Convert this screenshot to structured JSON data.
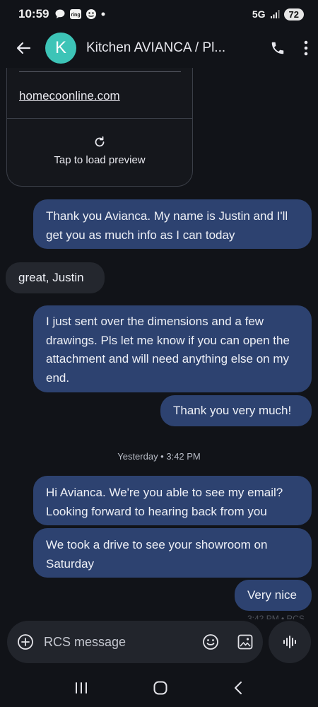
{
  "status_bar": {
    "time": "10:59",
    "network": "5G",
    "battery": "72",
    "icons": [
      "chat-bubble-icon",
      "ring-app-icon",
      "emoji-status-icon",
      "dot-icon",
      "signal-icon"
    ]
  },
  "app_bar": {
    "avatar_letter": "K",
    "avatar_color": "#3dc4b7",
    "title": "Kitchen AVIANCA / Pl..."
  },
  "link_preview": {
    "domain": "homecoonline.com",
    "action_label": "Tap to load preview"
  },
  "messages": [
    {
      "direction": "outgoing",
      "text": "Thank you Avianca.  My name is Justin and I'll get you as much info as I can today"
    },
    {
      "direction": "incoming",
      "text": "great, Justin"
    },
    {
      "direction": "outgoing",
      "text": "I just sent over the dimensions and a few drawings.  Pls let me know if you can open the attachment and will need anything else on my end."
    },
    {
      "direction": "outgoing",
      "text": "Thank you very much!"
    },
    {
      "direction": "outgoing",
      "text": "Hi Avianca.  We're you able to see my email? Looking forward to hearing back from you"
    },
    {
      "direction": "outgoing",
      "text": "We took a drive to see your showroom on Saturday"
    },
    {
      "direction": "outgoing",
      "text": "Very nice"
    }
  ],
  "timestamp_divider": "Yesterday • 3:42 PM",
  "faded_timestamp": "3:42 PM • RCS",
  "composer": {
    "placeholder": "RCS message"
  },
  "colors": {
    "background": "#111318",
    "outgoing_bubble": "#2d4270",
    "incoming_bubble": "#24272e",
    "composer": "#22252c"
  }
}
